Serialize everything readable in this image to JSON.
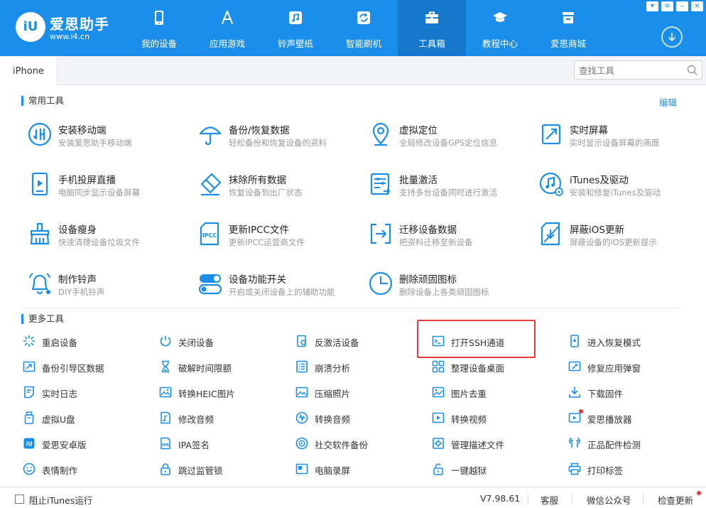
{
  "app": {
    "name": "爱思助手",
    "url": "www.i4.cn",
    "badge": "iU"
  },
  "nav": [
    {
      "label": "我的设备",
      "icon": "phone-icon"
    },
    {
      "label": "应用游戏",
      "icon": "app-store-icon"
    },
    {
      "label": "铃声壁纸",
      "icon": "music-icon"
    },
    {
      "label": "智能刷机",
      "icon": "refresh-box-icon"
    },
    {
      "label": "工具箱",
      "icon": "toolbox-icon",
      "active": true
    },
    {
      "label": "教程中心",
      "icon": "graduation-cap-icon"
    },
    {
      "label": "爱思商城",
      "icon": "store-icon"
    }
  ],
  "tabs": [
    {
      "label": "iPhone"
    }
  ],
  "search": {
    "placeholder": "查找工具"
  },
  "common_section": {
    "title": "常用工具",
    "edit": "编辑",
    "tools": [
      {
        "title": "安装移动端",
        "desc": "安装爱思助手移动端"
      },
      {
        "title": "备份/恢复数据",
        "desc": "轻松备份和恢复设备的资料"
      },
      {
        "title": "虚拟定位",
        "desc": "全局修改设备GPS定位信息"
      },
      {
        "title": "实时屏幕",
        "desc": "实时显示设备屏幕的画面"
      },
      {
        "title": "手机投屏直播",
        "desc": "电脑同步显示设备屏幕"
      },
      {
        "title": "抹除所有数据",
        "desc": "恢复设备到出厂状态"
      },
      {
        "title": "批量激活",
        "desc": "支持多台设备同时进行激活"
      },
      {
        "title": "iTunes及驱动",
        "desc": "安装和修复iTunes及驱动"
      },
      {
        "title": "设备瘦身",
        "desc": "快速清理设备垃圾文件"
      },
      {
        "title": "更新IPCC文件",
        "desc": "更新IPCC运营商文件"
      },
      {
        "title": "迁移设备数据",
        "desc": "把资料迁移至新设备"
      },
      {
        "title": "屏蔽iOS更新",
        "desc": "屏蔽设备的iOS更新提示"
      },
      {
        "title": "制作铃声",
        "desc": "DIY手机铃声"
      },
      {
        "title": "设备功能开关",
        "desc": "开启或关闭设备上的辅助功能"
      },
      {
        "title": "删除顽固图标",
        "desc": "删除设备上各类顽固图标"
      }
    ]
  },
  "more_section": {
    "title": "更多工具",
    "tools": [
      "重启设备",
      "关闭设备",
      "反激活设备",
      "打开SSH通道",
      "进入恢复模式",
      "备份引导区数据",
      "破解时间限额",
      "崩溃分析",
      "整理设备桌面",
      "修复应用弹窗",
      "实时日志",
      "转换HEIC图片",
      "压缩照片",
      "图片去重",
      "下载固件",
      "虚拟U盘",
      "修改音频",
      "转换音频",
      "转换视频",
      "爱思播放器",
      "爱思安卓版",
      "IPA签名",
      "社交软件备份",
      "管理描述文件",
      "正品配件检测",
      "表情制作",
      "跳过监管锁",
      "电脑录屏",
      "一键越狱",
      "打印标签"
    ]
  },
  "status": {
    "block_itunes": "阻止iTunes运行",
    "version": "V7.98.61",
    "service": "客服",
    "wechat": "微信公众号",
    "check_update": "检查更新"
  },
  "colors": {
    "accent": "#1b8dea",
    "active_nav": "#1578cc",
    "highlight": "#e33b3b"
  }
}
